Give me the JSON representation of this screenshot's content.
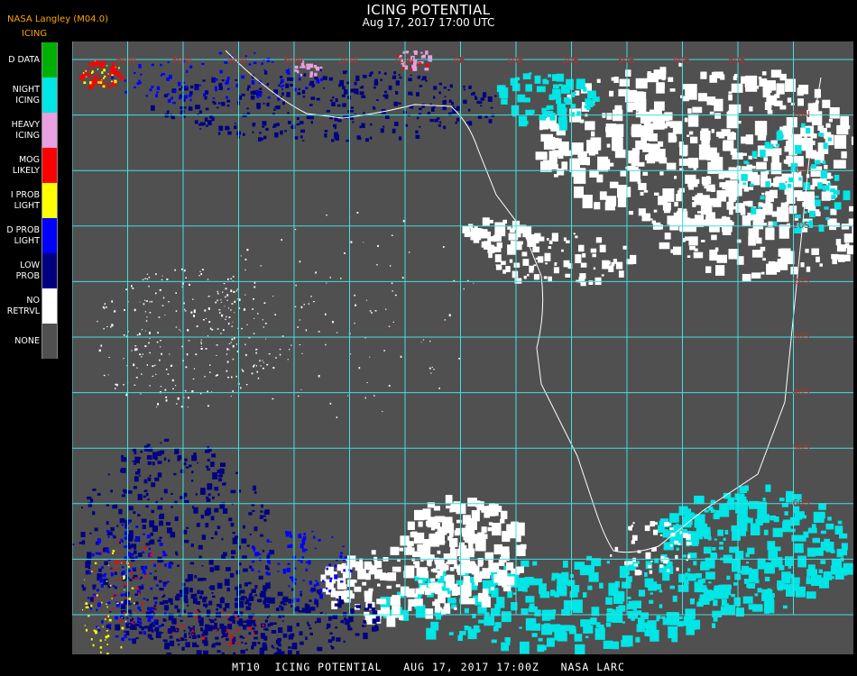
{
  "header": {
    "source": "NASA Langley (M04.0)",
    "legend_title": "ICING",
    "title": "ICING POTENTIAL",
    "subtitle": "Aug 17, 2017 17:00 UTC"
  },
  "legend": [
    {
      "label": "D DATA",
      "color": "#00b000"
    },
    {
      "label": "NIGHT\nICING",
      "color": "#00e5e5"
    },
    {
      "label": "HEAVY\nICING",
      "color": "#e8a0e0"
    },
    {
      "label": "MOG\nLIKELY",
      "color": "#ff0000"
    },
    {
      "label": "I PROB\nLIGHT",
      "color": "#ffff00"
    },
    {
      "label": "D PROB\nLIGHT",
      "color": "#0000ff"
    },
    {
      "label": "LOW\nPROB",
      "color": "#000080"
    },
    {
      "label": "NO\nRETRVL",
      "color": "#ffffff"
    },
    {
      "label": "NONE",
      "color": "#505050"
    }
  ],
  "map": {
    "background_color": "#505050",
    "grid_color": "#40e0e0",
    "label_color": "#b03030",
    "lon_labels": [
      "60W",
      "50W",
      "40W",
      "30W",
      "20W",
      "10W",
      "0E",
      "10E",
      "20E",
      "30E",
      "40E",
      "50E"
    ],
    "lat_labels": [
      "10N",
      "0N",
      "10S",
      "20S",
      "30S",
      "40S",
      "50S",
      "60S"
    ]
  },
  "footer": "MT10  ICING POTENTIAL   AUG 17, 2017 17:00Z   NASA LARC"
}
